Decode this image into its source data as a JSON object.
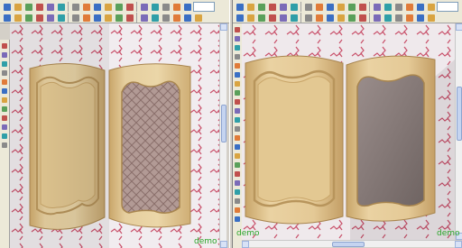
{
  "left_pane": {
    "toolbar_row1_icons": [
      "new-icon",
      "open-icon",
      "save-icon",
      "print-icon",
      "print-preview-icon",
      "properties-icon",
      "cut-icon",
      "copy-icon",
      "paste-icon",
      "undo-icon",
      "redo-icon",
      "zoom-icon",
      "zoom-window-icon",
      "zoom-all-icon",
      "rotate-icon",
      "pan-icon",
      "settings-icon",
      "list-icon",
      "layers-icon",
      "grid-icon",
      "help-icon"
    ],
    "toolbar_row2_icons": [
      "select-icon",
      "move-icon",
      "copy-obj-icon",
      "mirror-icon",
      "rotate-obj-icon",
      "scale-icon",
      "panel-icon",
      "door-icon",
      "drawer-icon",
      "shelf-icon",
      "material-icon",
      "texture-icon",
      "light-icon",
      "camera-icon",
      "measure-icon",
      "render-icon",
      "snap-icon",
      "coordinates-icon"
    ],
    "zoom_value": "",
    "demo_label": "demo"
  },
  "right_pane": {
    "toolbar_row1_icons": [
      "home-icon",
      "open-icon",
      "save-icon",
      "back-icon",
      "forward-icon",
      "search-icon",
      "view-front-icon",
      "view-top-icon",
      "view-side-icon",
      "view-3d-icon",
      "wireframe-icon",
      "shaded-icon",
      "render-icon",
      "light-icon",
      "camera-icon",
      "globe-icon",
      "walk-icon",
      "fly-icon",
      "zoom-in-icon",
      "zoom-out-icon",
      "settings-icon",
      "close-icon"
    ],
    "toolbar_row2_icons": [
      "new-icon",
      "open-icon",
      "save-icon",
      "print-icon",
      "cut-icon",
      "copy-icon",
      "paste-icon",
      "undo-icon",
      "select-icon",
      "move-icon",
      "rotate-icon",
      "scale-icon",
      "material-icon",
      "texture-icon",
      "light-icon",
      "camera-icon",
      "measure-icon",
      "help-icon"
    ],
    "zoom_value": "",
    "demo_label_left": "demo",
    "demo_label_right": "demo"
  },
  "colors": {
    "toolbar_bg": "#ece9d8",
    "wood_light": "#e6cf9f",
    "wood_mid": "#d7b980",
    "wood_dark": "#b8955c",
    "wallpaper_bg": "#f1ecef",
    "wallpaper_motif": "#c9506a",
    "glass": "#8a8080",
    "demo_text": "#2aa52a",
    "accent": "#316ac5"
  }
}
